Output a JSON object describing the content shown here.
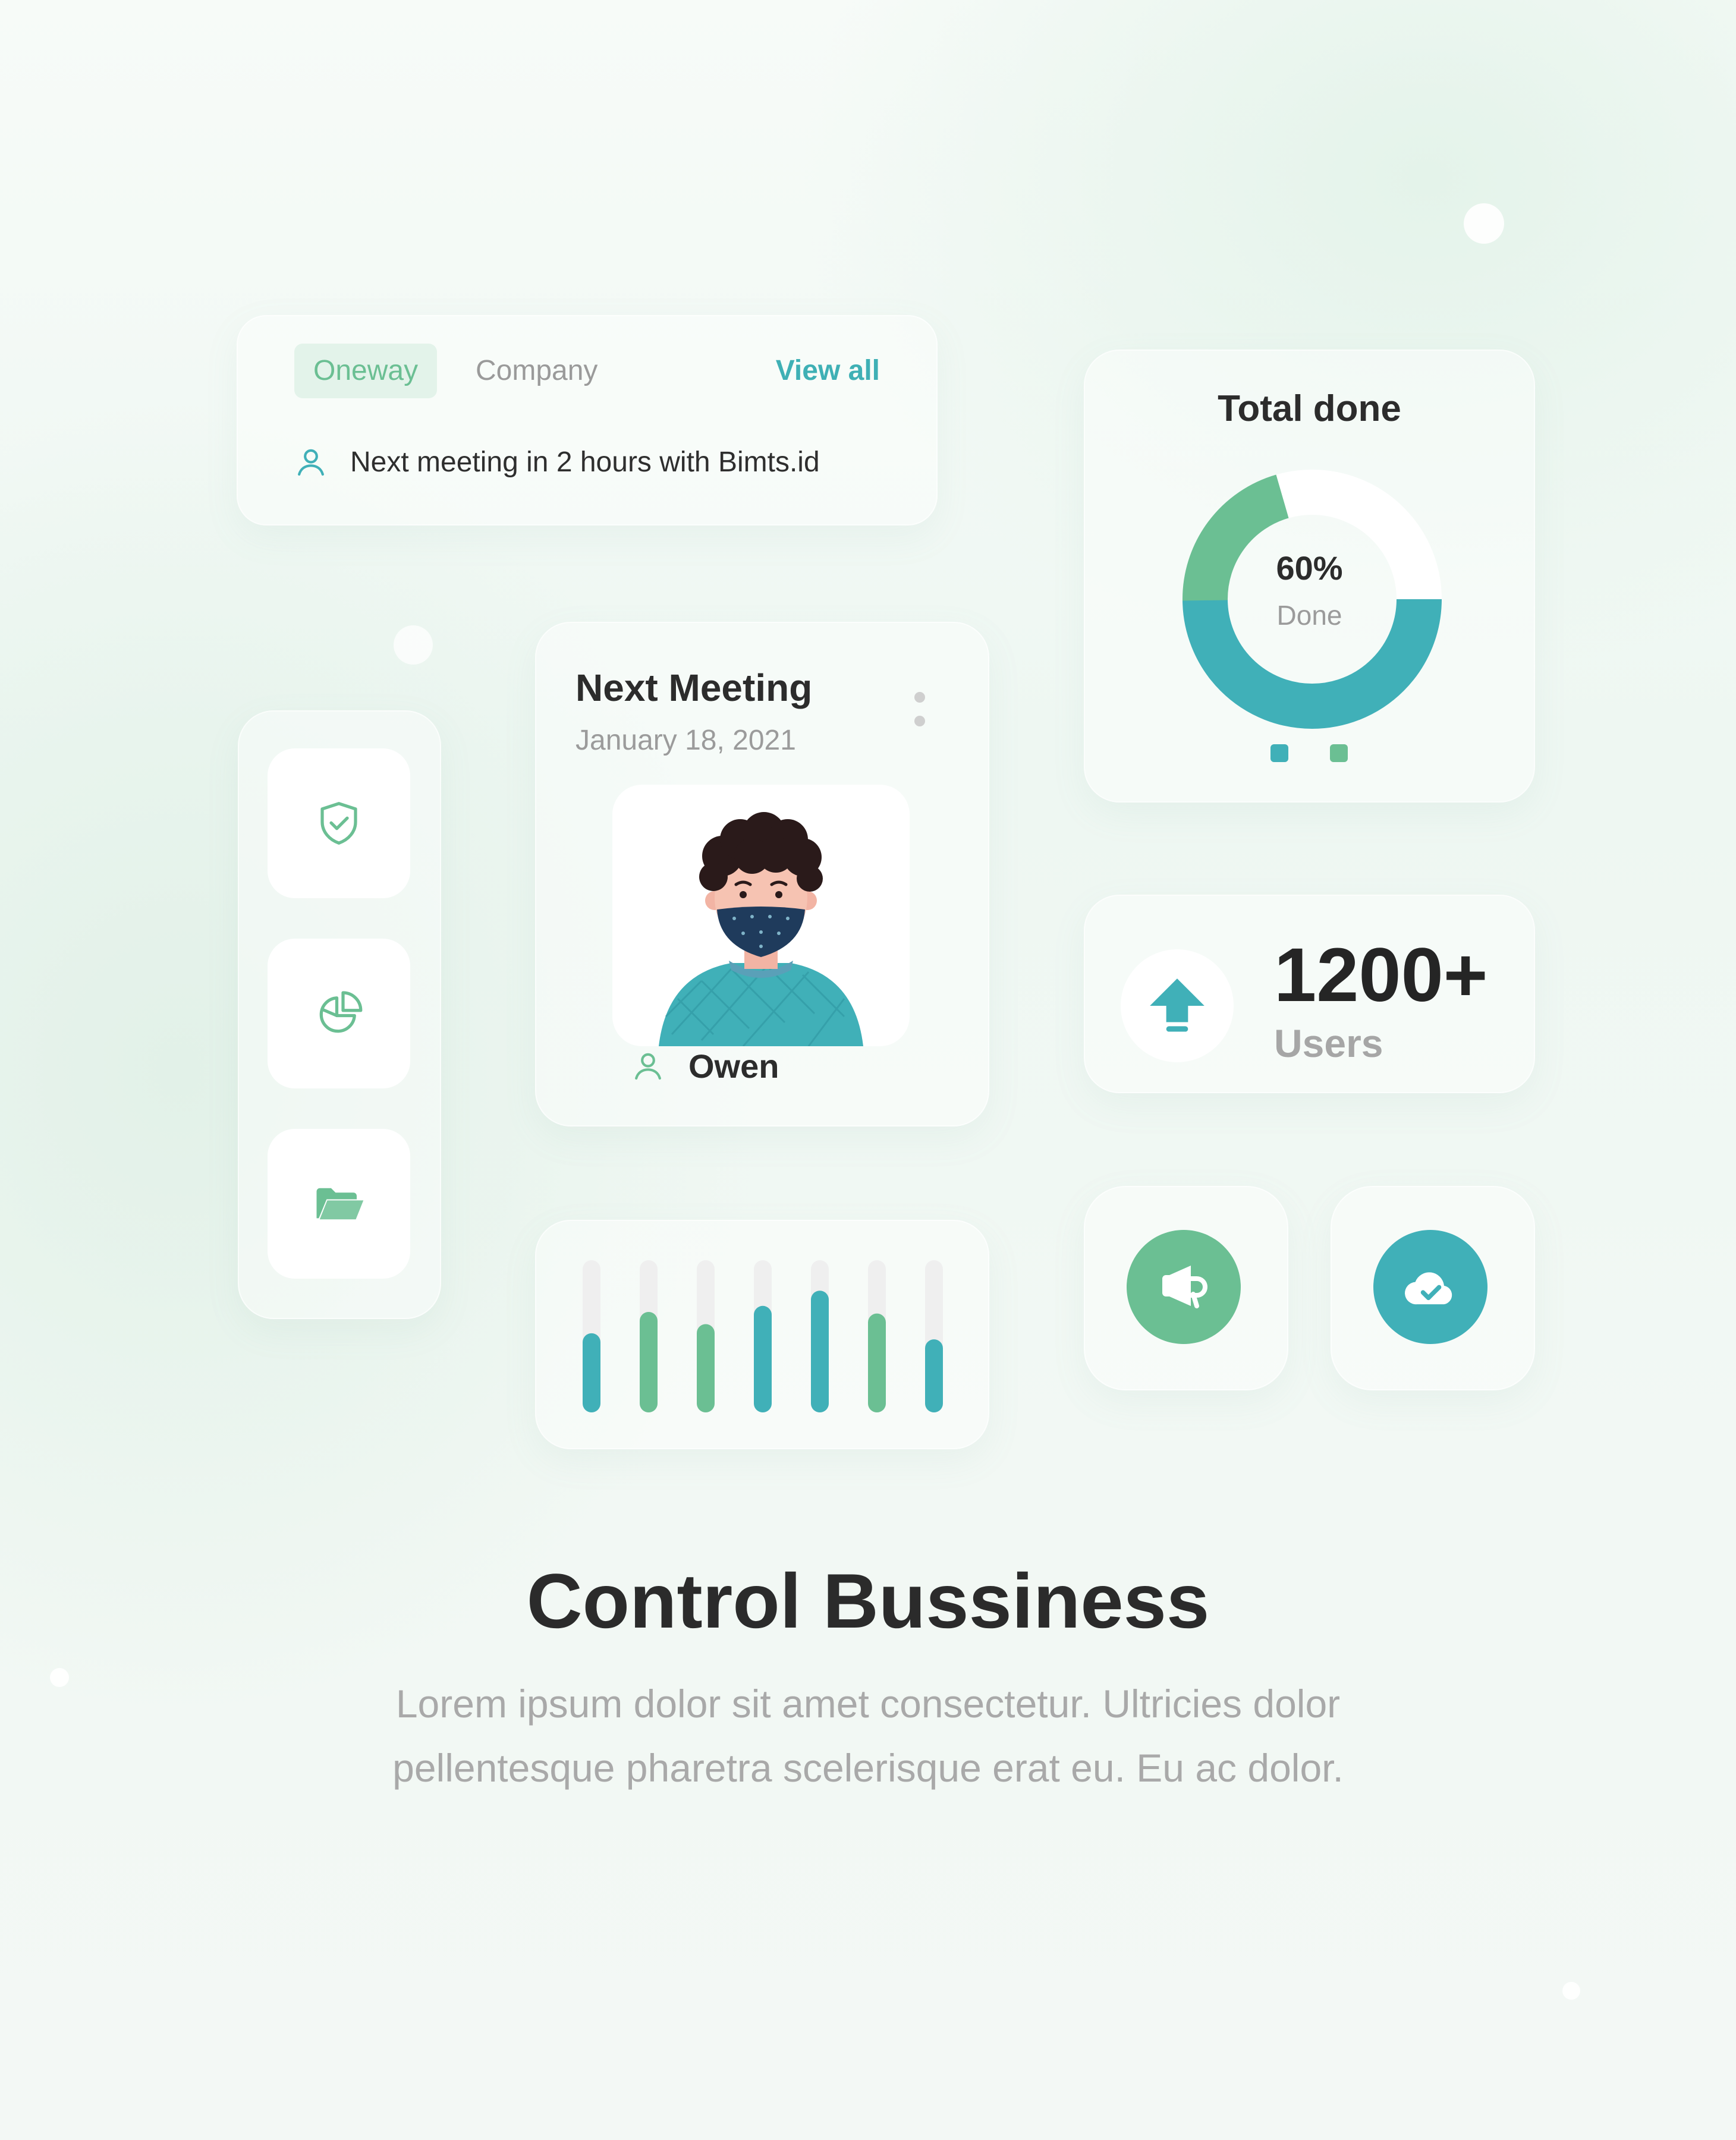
{
  "tabs_card": {
    "tab_active": "Oneway",
    "tab_inactive": "Company",
    "view_all": "View all",
    "meeting_text": "Next meeting in 2 hours with Bimts.id"
  },
  "total_card": {
    "title": "Total done",
    "percent_label": "60%",
    "done_label": "Done",
    "progress": 0.6,
    "colors": {
      "green": "#6bbf93",
      "teal": "#40b0b8",
      "track": "#ffffff"
    }
  },
  "meeting_card": {
    "title": "Next Meeting",
    "date": "January 18, 2021",
    "person_name": "Owen"
  },
  "sidebar": {
    "items": [
      {
        "icon": "shield-check-icon"
      },
      {
        "icon": "pie-chart-icon"
      },
      {
        "icon": "folder-open-icon"
      }
    ]
  },
  "users_card": {
    "count": "1200+",
    "label": "Users",
    "icon": "upload-arrow-icon"
  },
  "actions": [
    {
      "icon": "megaphone-icon",
      "color": "#6bbf93"
    },
    {
      "icon": "cloud-check-icon",
      "color": "#40b0b8"
    }
  ],
  "bar_chart": {
    "bars": [
      {
        "value": 0.52,
        "color": "teal"
      },
      {
        "value": 0.66,
        "color": "green"
      },
      {
        "value": 0.58,
        "color": "green"
      },
      {
        "value": 0.7,
        "color": "teal"
      },
      {
        "value": 0.8,
        "color": "teal"
      },
      {
        "value": 0.65,
        "color": "green"
      },
      {
        "value": 0.48,
        "color": "teal"
      }
    ]
  },
  "headline": "Control Bussiness",
  "description_line1": "Lorem ipsum dolor sit amet consectetur. Ultricies dolor",
  "description_line2": "pellentesque pharetra scelerisque erat eu. Eu ac dolor."
}
